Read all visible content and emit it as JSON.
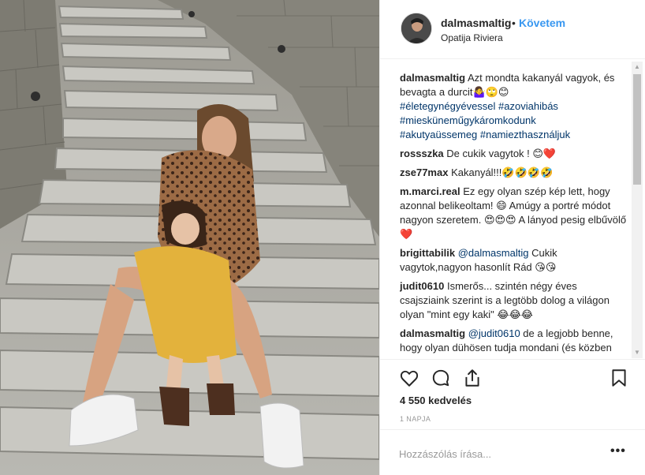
{
  "post": {
    "username": "dalmasmaltig",
    "dot": "•",
    "follow_label": "Követem",
    "location": "Opatija Riviera"
  },
  "comments": [
    {
      "user": "dalmasmaltig",
      "text": "Azt mondta kakanyál vagyok, és bevagta a durcit🤷‍♀️🙄😊",
      "tags": [
        "#életegynégyévessel",
        "#azoviahibás",
        "#miesküneműgykáromkodunk",
        "#akutyaüssemeg",
        "#namiezthasználjuk"
      ]
    },
    {
      "user": "rossszka",
      "text": "De cukik vagytok ! 😊❤️"
    },
    {
      "user": "zse77max",
      "text": "Kakanyál!!!🤣🤣🤣🤣"
    },
    {
      "user": "m.marci.real",
      "text": "Ez egy olyan szép kép lett, hogy azonnal belikeoltam! 😄 Amúgy a portré módot nagyon szeretem. 😍😍😍 A lányod pesig elbűvölő ❤️"
    },
    {
      "user": "brigittabilik",
      "mention": "@dalmasmaltig",
      "text": " Cukik vagytok,nagyon hasonlít Rád 😘😘"
    },
    {
      "user": "judit0610",
      "text": "Ismerős... szintén négy éves csajsziaink szerint is a legtöbb dolog a világon olyan \"mint egy kaki\" 😂😂😂"
    },
    {
      "user": "dalmasmaltig",
      "mention": "@judit0610",
      "text": " de a legjobb benne, hogy olyan dühösen tudja mondani (és közben pot a kis lába is) 😂🙈"
    }
  ],
  "likes": "4 550 kedvelés",
  "time": "1 NAPJA",
  "add_comment": {
    "placeholder": "Hozzászólás írása..."
  },
  "more": "•••",
  "icons": {
    "like": "heart-outline-icon",
    "comment": "speech-bubble-icon",
    "share": "share-icon",
    "save": "bookmark-icon"
  },
  "colors": {
    "link": "#3897f0",
    "hashtag": "#003569",
    "muted": "#999999",
    "text": "#262626"
  }
}
